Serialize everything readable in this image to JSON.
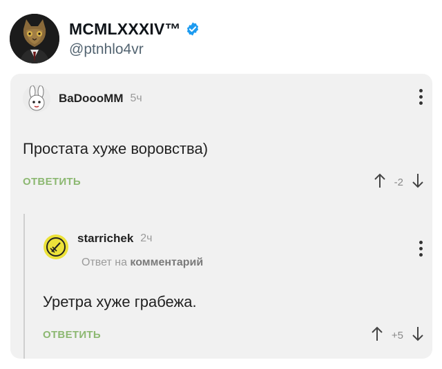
{
  "tweet": {
    "display_name": "MCMLXXXIV™",
    "handle": "@ptnhlo4vr",
    "verified_icon": "verified-badge-icon",
    "accent_color": "#1d9bf0"
  },
  "post": {
    "comment": {
      "username": "BaDoooMM",
      "time": "5ч",
      "text": "Простата хуже воровства)",
      "reply_label": "ОТВЕТИТЬ",
      "score": "-2"
    },
    "reply": {
      "username": "starrichek",
      "time": "2ч",
      "reply_to_prefix": "Ответ на",
      "reply_to_target": "комментарий",
      "text": "Уретра хуже грабежа.",
      "reply_label": "ОТВЕТИТЬ",
      "score": "+5"
    },
    "reply_color": "#8cb871"
  }
}
